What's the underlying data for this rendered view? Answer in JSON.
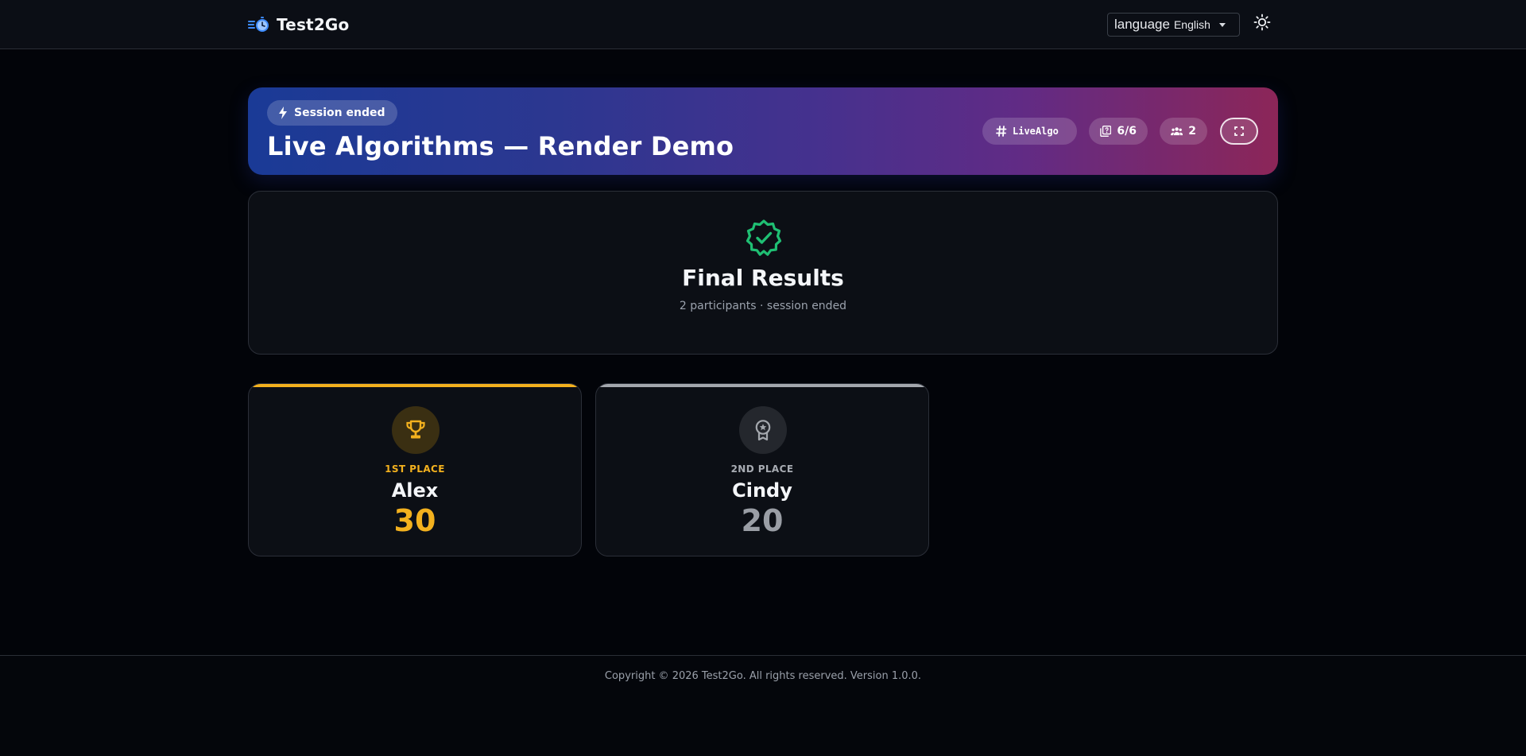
{
  "header": {
    "brand_name": "Test2Go",
    "language_icon_text": "language",
    "language_value": "English",
    "theme_icon": "sun-icon"
  },
  "hero": {
    "status_badge": "Session ended",
    "title": "Live Algorithms — Render Demo",
    "session_code": "LiveAlgo",
    "questions_progress": "6/6",
    "participants_count": "2"
  },
  "results": {
    "title": "Final Results",
    "subtitle": "2 participants · session ended"
  },
  "podium": [
    {
      "place_label": "1ST PLACE",
      "name": "Alex",
      "score": "30",
      "icon": "trophy-icon",
      "accent": "#f3b11e"
    },
    {
      "place_label": "2ND PLACE",
      "name": "Cindy",
      "score": "20",
      "icon": "medal-icon",
      "accent": "#a3a7ad"
    }
  ],
  "footer": {
    "copyright": "Copyright © 2026 Test2Go. All rights reserved. Version 1.0.0."
  },
  "colors": {
    "background": "#020409",
    "success": "#1fbf73",
    "gold": "#f3b11e",
    "silver": "#a3a7ad",
    "hero_gradient_start": "#1a3a96",
    "hero_gradient_end": "#8c2658"
  }
}
